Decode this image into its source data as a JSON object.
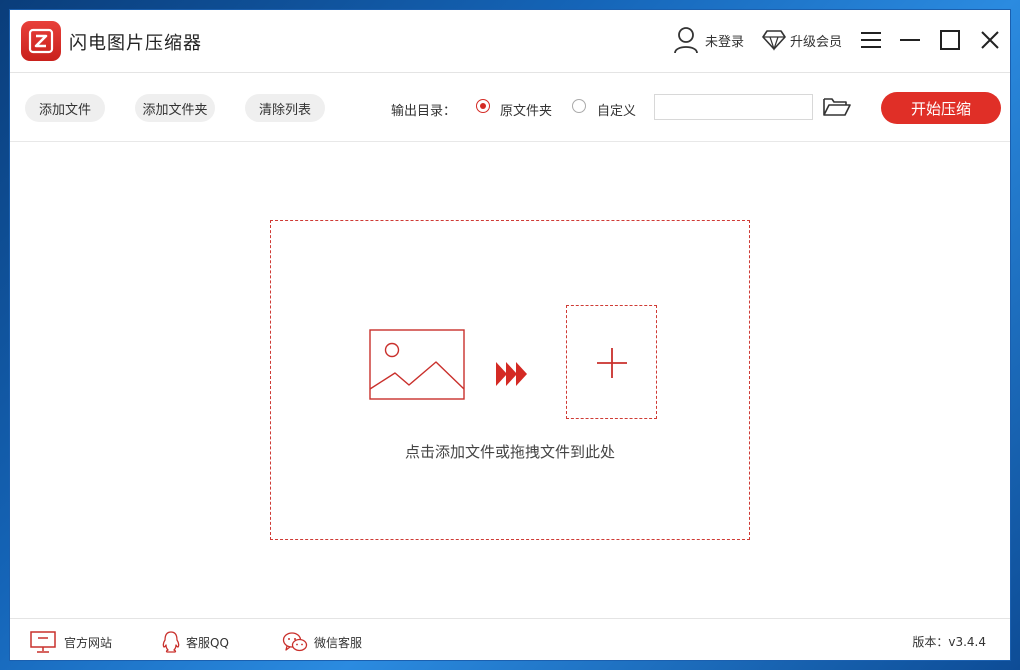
{
  "app": {
    "title": "闪电图片压缩器",
    "brand_color": "#e02f27"
  },
  "header": {
    "login_label": "未登录",
    "vip_label": "升级会员"
  },
  "toolbar": {
    "add_file": "添加文件",
    "add_folder": "添加文件夹",
    "clear_list": "清除列表",
    "output_label": "输出目录：",
    "option_original": "原文件夹",
    "option_custom": "自定义",
    "output_path": "",
    "start": "开始压缩"
  },
  "dropzone": {
    "hint": "点击添加文件或拖拽文件到此处"
  },
  "footer": {
    "website": "官方网站",
    "qq": "客服QQ",
    "wechat": "微信客服",
    "version": "版本：v3.4.4"
  }
}
